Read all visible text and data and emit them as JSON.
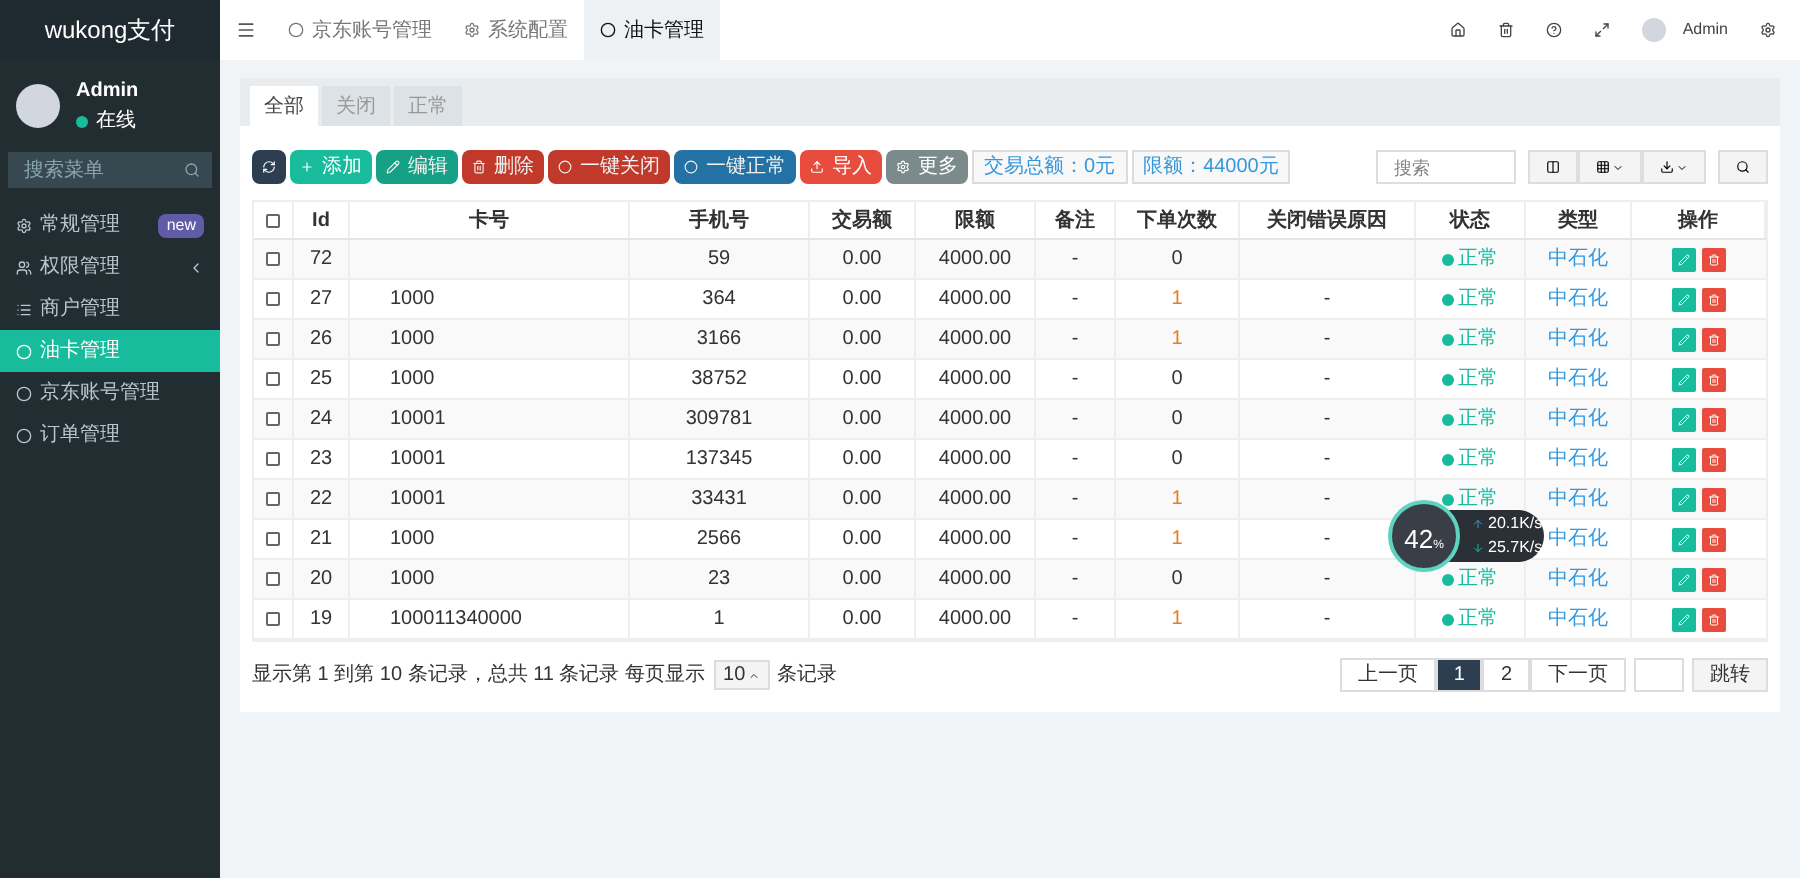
{
  "sidebar": {
    "brand": "wukong支付",
    "user": {
      "name": "Admin",
      "status": "在线"
    },
    "search": {
      "placeholder": "搜索菜单"
    },
    "items": [
      {
        "label": "常规管理",
        "badge": "new",
        "has_children": false,
        "selected": false
      },
      {
        "label": "权限管理",
        "has_children": true,
        "selected": false
      },
      {
        "label": "商户管理",
        "has_children": false,
        "selected": false
      },
      {
        "label": "油卡管理",
        "has_children": false,
        "selected": true
      },
      {
        "label": "京东账号管理",
        "has_children": false,
        "selected": false
      },
      {
        "label": "订单管理",
        "has_children": false,
        "selected": false
      }
    ]
  },
  "topbar": {
    "tabs": [
      {
        "label": "京东账号管理",
        "selected": false
      },
      {
        "label": "系统配置",
        "selected": false
      },
      {
        "label": "油卡管理",
        "selected": true
      }
    ],
    "user": "Admin"
  },
  "filter_tabs": [
    {
      "label": "全部",
      "selected": true
    },
    {
      "label": "关闭",
      "selected": false
    },
    {
      "label": "正常",
      "selected": false
    }
  ],
  "toolbar": {
    "buttons": [
      {
        "kind": "refresh",
        "disabled": false
      },
      {
        "kind": "add",
        "label": "添加",
        "disabled": false
      },
      {
        "kind": "edit",
        "label": "编辑",
        "disabled": true
      },
      {
        "kind": "delete",
        "label": "删除",
        "disabled": true
      },
      {
        "kind": "close_all",
        "label": "一键关闭",
        "disabled": true
      },
      {
        "kind": "enable_all",
        "label": "一键正常",
        "disabled": true
      },
      {
        "kind": "import",
        "label": "导入",
        "disabled": false
      },
      {
        "kind": "more",
        "label": "更多",
        "disabled": false
      }
    ],
    "stats": [
      "交易总额：0元",
      "限额：44000元"
    ],
    "search": {
      "placeholder": "搜索"
    }
  },
  "table": {
    "select_all_checked": false,
    "columns": [
      "Id",
      "卡号",
      "手机号",
      "交易额",
      "限额",
      "备注",
      "下单次数",
      "关闭错误原因",
      "状态",
      "类型",
      "操作"
    ],
    "rows": [
      {
        "id": "72",
        "checked": false,
        "card": "",
        "phone": "59",
        "amount": "0.00",
        "limit": "4000.00",
        "note": "-",
        "orders": "0",
        "reason": "",
        "status": "正常",
        "type": "中石化"
      },
      {
        "id": "27",
        "checked": false,
        "card": "1000",
        "phone": "364",
        "amount": "0.00",
        "limit": "4000.00",
        "note": "-",
        "orders": "1",
        "reason": "-",
        "status": "正常",
        "type": "中石化"
      },
      {
        "id": "26",
        "checked": false,
        "card": "1000",
        "phone": "3166",
        "amount": "0.00",
        "limit": "4000.00",
        "note": "-",
        "orders": "1",
        "reason": "-",
        "status": "正常",
        "type": "中石化"
      },
      {
        "id": "25",
        "checked": false,
        "card": "1000",
        "phone": "38752",
        "amount": "0.00",
        "limit": "4000.00",
        "note": "-",
        "orders": "0",
        "reason": "-",
        "status": "正常",
        "type": "中石化"
      },
      {
        "id": "24",
        "checked": false,
        "card": "10001",
        "phone": "309781",
        "amount": "0.00",
        "limit": "4000.00",
        "note": "-",
        "orders": "0",
        "reason": "-",
        "status": "正常",
        "type": "中石化"
      },
      {
        "id": "23",
        "checked": false,
        "card": "10001",
        "phone": "137345",
        "amount": "0.00",
        "limit": "4000.00",
        "note": "-",
        "orders": "0",
        "reason": "-",
        "status": "正常",
        "type": "中石化"
      },
      {
        "id": "22",
        "checked": false,
        "card": "10001",
        "phone": "33431",
        "amount": "0.00",
        "limit": "4000.00",
        "note": "-",
        "orders": "1",
        "reason": "-",
        "status": "正常",
        "type": "中石化"
      },
      {
        "id": "21",
        "checked": false,
        "card": "1000",
        "phone": "2566",
        "amount": "0.00",
        "limit": "4000.00",
        "note": "-",
        "orders": "1",
        "reason": "-",
        "type": "中石化"
      },
      {
        "id": "20",
        "checked": false,
        "card": "1000",
        "phone": "23",
        "amount": "0.00",
        "limit": "4000.00",
        "note": "-",
        "orders": "0",
        "reason": "-",
        "status": "正常",
        "type": "中石化"
      },
      {
        "id": "19",
        "checked": false,
        "card": "100011340000",
        "phone": "1",
        "amount": "0.00",
        "limit": "4000.00",
        "note": "-",
        "orders": "1",
        "reason": "-",
        "status": "正常",
        "type": "中石化"
      }
    ]
  },
  "footer": {
    "summary": "显示第 1 到第 10 条记录，总共 11 条记录 每页显示",
    "page_size": "10",
    "suffix": "条记录",
    "pages": [
      {
        "label": "上一页",
        "selected": false
      },
      {
        "label": "1",
        "selected": true
      },
      {
        "label": "2",
        "selected": false
      },
      {
        "label": "下一页",
        "selected": false
      }
    ],
    "jump": "跳转"
  },
  "speed_widget": {
    "percent": "42",
    "unit": "%",
    "up": "20.1K/s",
    "down": "25.7K/s"
  }
}
